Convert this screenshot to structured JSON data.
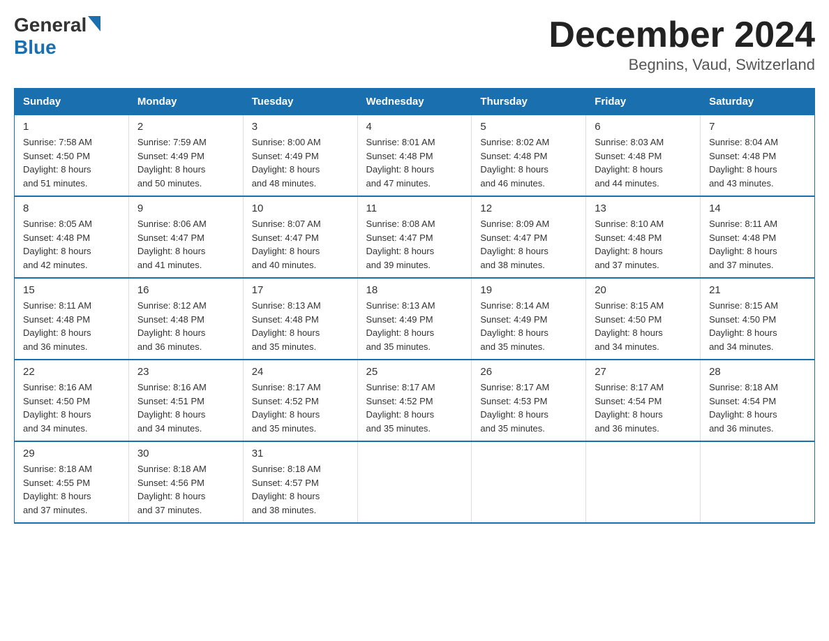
{
  "header": {
    "logo_general": "General",
    "logo_blue": "Blue",
    "month_title": "December 2024",
    "location": "Begnins, Vaud, Switzerland"
  },
  "days_of_week": [
    "Sunday",
    "Monday",
    "Tuesday",
    "Wednesday",
    "Thursday",
    "Friday",
    "Saturday"
  ],
  "weeks": [
    [
      {
        "day": "1",
        "sunrise": "7:58 AM",
        "sunset": "4:50 PM",
        "daylight": "8 hours and 51 minutes."
      },
      {
        "day": "2",
        "sunrise": "7:59 AM",
        "sunset": "4:49 PM",
        "daylight": "8 hours and 50 minutes."
      },
      {
        "day": "3",
        "sunrise": "8:00 AM",
        "sunset": "4:49 PM",
        "daylight": "8 hours and 48 minutes."
      },
      {
        "day": "4",
        "sunrise": "8:01 AM",
        "sunset": "4:48 PM",
        "daylight": "8 hours and 47 minutes."
      },
      {
        "day": "5",
        "sunrise": "8:02 AM",
        "sunset": "4:48 PM",
        "daylight": "8 hours and 46 minutes."
      },
      {
        "day": "6",
        "sunrise": "8:03 AM",
        "sunset": "4:48 PM",
        "daylight": "8 hours and 44 minutes."
      },
      {
        "day": "7",
        "sunrise": "8:04 AM",
        "sunset": "4:48 PM",
        "daylight": "8 hours and 43 minutes."
      }
    ],
    [
      {
        "day": "8",
        "sunrise": "8:05 AM",
        "sunset": "4:48 PM",
        "daylight": "8 hours and 42 minutes."
      },
      {
        "day": "9",
        "sunrise": "8:06 AM",
        "sunset": "4:47 PM",
        "daylight": "8 hours and 41 minutes."
      },
      {
        "day": "10",
        "sunrise": "8:07 AM",
        "sunset": "4:47 PM",
        "daylight": "8 hours and 40 minutes."
      },
      {
        "day": "11",
        "sunrise": "8:08 AM",
        "sunset": "4:47 PM",
        "daylight": "8 hours and 39 minutes."
      },
      {
        "day": "12",
        "sunrise": "8:09 AM",
        "sunset": "4:47 PM",
        "daylight": "8 hours and 38 minutes."
      },
      {
        "day": "13",
        "sunrise": "8:10 AM",
        "sunset": "4:48 PM",
        "daylight": "8 hours and 37 minutes."
      },
      {
        "day": "14",
        "sunrise": "8:11 AM",
        "sunset": "4:48 PM",
        "daylight": "8 hours and 37 minutes."
      }
    ],
    [
      {
        "day": "15",
        "sunrise": "8:11 AM",
        "sunset": "4:48 PM",
        "daylight": "8 hours and 36 minutes."
      },
      {
        "day": "16",
        "sunrise": "8:12 AM",
        "sunset": "4:48 PM",
        "daylight": "8 hours and 36 minutes."
      },
      {
        "day": "17",
        "sunrise": "8:13 AM",
        "sunset": "4:48 PM",
        "daylight": "8 hours and 35 minutes."
      },
      {
        "day": "18",
        "sunrise": "8:13 AM",
        "sunset": "4:49 PM",
        "daylight": "8 hours and 35 minutes."
      },
      {
        "day": "19",
        "sunrise": "8:14 AM",
        "sunset": "4:49 PM",
        "daylight": "8 hours and 35 minutes."
      },
      {
        "day": "20",
        "sunrise": "8:15 AM",
        "sunset": "4:50 PM",
        "daylight": "8 hours and 34 minutes."
      },
      {
        "day": "21",
        "sunrise": "8:15 AM",
        "sunset": "4:50 PM",
        "daylight": "8 hours and 34 minutes."
      }
    ],
    [
      {
        "day": "22",
        "sunrise": "8:16 AM",
        "sunset": "4:50 PM",
        "daylight": "8 hours and 34 minutes."
      },
      {
        "day": "23",
        "sunrise": "8:16 AM",
        "sunset": "4:51 PM",
        "daylight": "8 hours and 34 minutes."
      },
      {
        "day": "24",
        "sunrise": "8:17 AM",
        "sunset": "4:52 PM",
        "daylight": "8 hours and 35 minutes."
      },
      {
        "day": "25",
        "sunrise": "8:17 AM",
        "sunset": "4:52 PM",
        "daylight": "8 hours and 35 minutes."
      },
      {
        "day": "26",
        "sunrise": "8:17 AM",
        "sunset": "4:53 PM",
        "daylight": "8 hours and 35 minutes."
      },
      {
        "day": "27",
        "sunrise": "8:17 AM",
        "sunset": "4:54 PM",
        "daylight": "8 hours and 36 minutes."
      },
      {
        "day": "28",
        "sunrise": "8:18 AM",
        "sunset": "4:54 PM",
        "daylight": "8 hours and 36 minutes."
      }
    ],
    [
      {
        "day": "29",
        "sunrise": "8:18 AM",
        "sunset": "4:55 PM",
        "daylight": "8 hours and 37 minutes."
      },
      {
        "day": "30",
        "sunrise": "8:18 AM",
        "sunset": "4:56 PM",
        "daylight": "8 hours and 37 minutes."
      },
      {
        "day": "31",
        "sunrise": "8:18 AM",
        "sunset": "4:57 PM",
        "daylight": "8 hours and 38 minutes."
      },
      null,
      null,
      null,
      null
    ]
  ],
  "labels": {
    "sunrise": "Sunrise: ",
    "sunset": "Sunset: ",
    "daylight": "Daylight: "
  }
}
